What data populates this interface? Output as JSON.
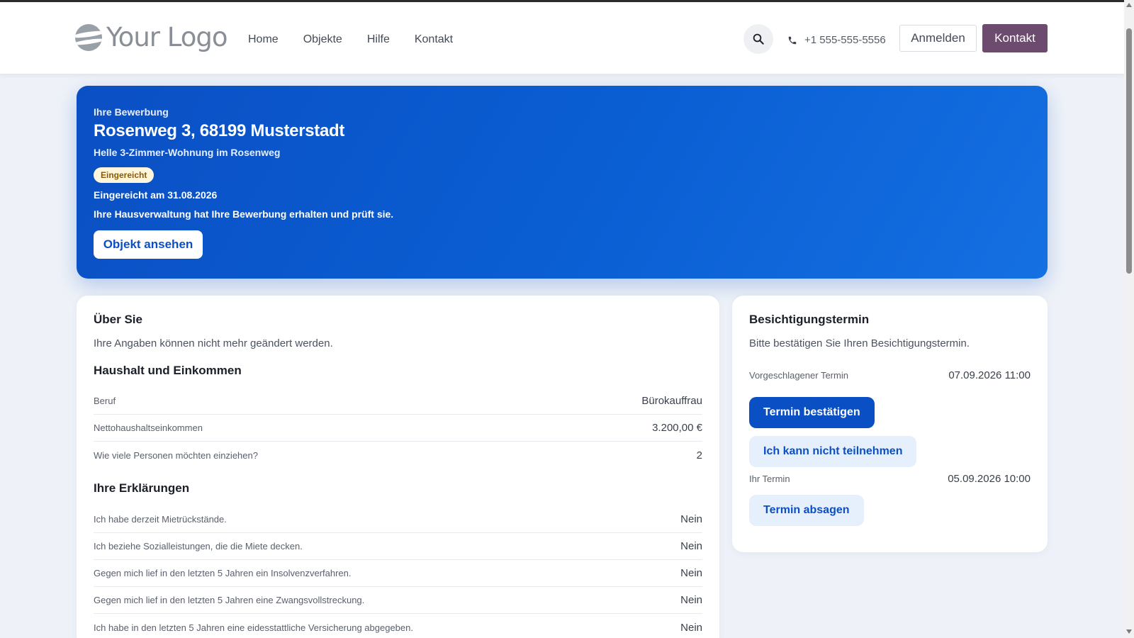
{
  "header": {
    "logo_text": "Your Logo",
    "nav": [
      "Home",
      "Objekte",
      "Hilfe",
      "Kontakt"
    ],
    "search_icon": "search-icon",
    "phone_icon": "phone-icon",
    "phone": "+1 555-555-5556",
    "login_label": "Anmelden",
    "contact_label": "Kontakt",
    "contact_color": "#6d4b6e"
  },
  "hero": {
    "eyebrow": "Ihre Bewerbung",
    "address": "Rosenweg 3, 68199 Musterstadt",
    "subtitle": "Helle 3-Zimmer-Wohnung im Rosenweg",
    "status_badge": "Eingereicht",
    "submitted": "Eingereicht am 31.08.2026",
    "info": "Ihre Hausverwaltung hat Ihre Bewerbung erhalten und prüft sie.",
    "button": "Objekt ansehen",
    "accent_color": "#0b4fc4"
  },
  "about": {
    "title": "Über Sie",
    "description": "Ihre Angaben können nicht mehr geändert werden.",
    "household": {
      "title": "Haushalt und Einkommen",
      "rows": [
        {
          "label": "Beruf",
          "value": "Bürokauffrau"
        },
        {
          "label": "Nettohaushaltseinkommen",
          "value": "3.200,00 €"
        },
        {
          "label": "Wie viele Personen möchten einziehen?",
          "value": "2"
        }
      ]
    },
    "declarations": {
      "title": "Ihre Erklärungen",
      "rows": [
        {
          "label": "Ich habe derzeit Mietrückstände.",
          "value": "Nein"
        },
        {
          "label": "Ich beziehe Sozialleistungen, die die Miete decken.",
          "value": "Nein"
        },
        {
          "label": "Gegen mich lief in den letzten 5 Jahren ein Insolvenzverfahren.",
          "value": "Nein"
        },
        {
          "label": "Gegen mich lief in den letzten 5 Jahren eine Zwangsvollstreckung.",
          "value": "Nein"
        },
        {
          "label": "Ich habe in den letzten 5 Jahren eine eidesstattliche Versicherung abgegeben.",
          "value": "Nein"
        }
      ]
    }
  },
  "viewing": {
    "title": "Besichtigungstermin",
    "description": "Bitte bestätigen Sie Ihren Besichtigungstermin.",
    "proposed_label": "Vorgeschlagener Termin",
    "proposed_value": "07.09.2026 11:00",
    "confirm_button": "Termin bestätigen",
    "decline_button": "Ich kann nicht teilnehmen",
    "your_label": "Ihr Termin",
    "your_value": "05.09.2026 10:00",
    "cancel_button": "Termin absagen"
  }
}
